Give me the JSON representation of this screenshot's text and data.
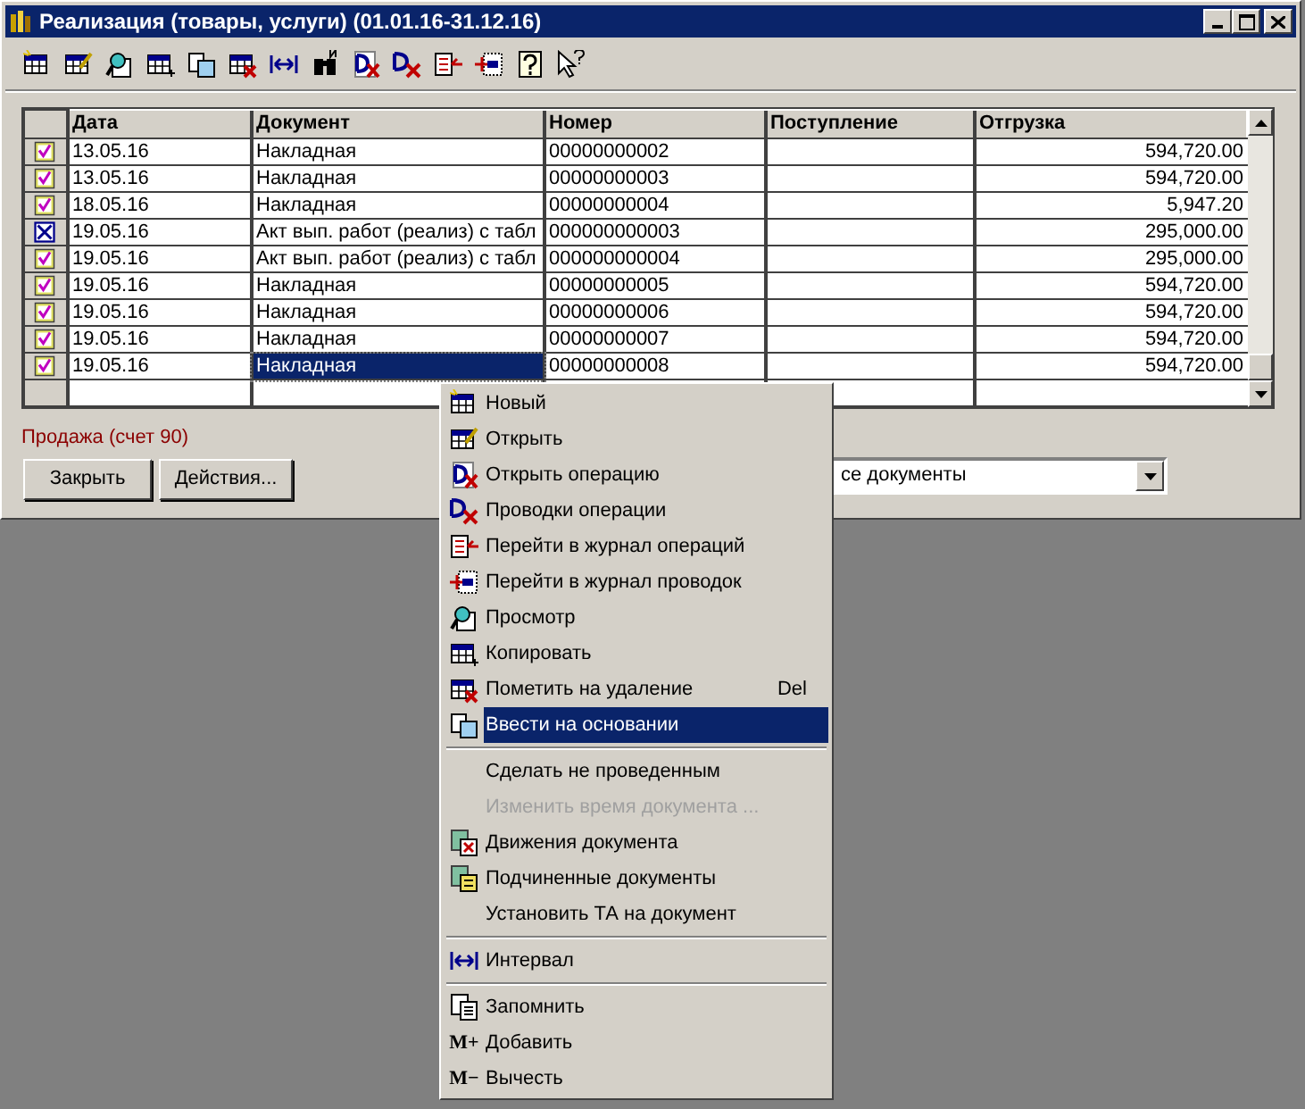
{
  "window": {
    "title": "Реализация (товары, услуги) (01.01.16-31.12.16)"
  },
  "table": {
    "columns": [
      "Дата",
      "Документ",
      "Номер",
      "Поступление",
      "Отгрузка"
    ],
    "rows": [
      {
        "deleted": false,
        "selected": false,
        "date": "13.05.16",
        "document": "Накладная",
        "number": "00000000002",
        "shipment": "594,720.00"
      },
      {
        "deleted": false,
        "selected": false,
        "date": "13.05.16",
        "document": "Накладная",
        "number": "00000000003",
        "shipment": "594,720.00"
      },
      {
        "deleted": false,
        "selected": false,
        "date": "18.05.16",
        "document": "Накладная",
        "number": "00000000004",
        "shipment": "5,947.20"
      },
      {
        "deleted": true,
        "selected": false,
        "date": "19.05.16",
        "document": "Акт вып. работ (реализ) с табл",
        "number": "000000000003",
        "shipment": "295,000.00"
      },
      {
        "deleted": false,
        "selected": false,
        "date": "19.05.16",
        "document": "Акт вып. работ (реализ) с табл",
        "number": "000000000004",
        "shipment": "295,000.00"
      },
      {
        "deleted": false,
        "selected": false,
        "date": "19.05.16",
        "document": "Накладная",
        "number": "00000000005",
        "shipment": "594,720.00"
      },
      {
        "deleted": false,
        "selected": false,
        "date": "19.05.16",
        "document": "Накладная",
        "number": "00000000006",
        "shipment": "594,720.00"
      },
      {
        "deleted": false,
        "selected": false,
        "date": "19.05.16",
        "document": "Накладная",
        "number": "00000000007",
        "shipment": "594,720.00"
      },
      {
        "deleted": false,
        "selected": true,
        "date": "19.05.16",
        "document": "Накладная",
        "number": "00000000008",
        "shipment": "594,720.00"
      }
    ]
  },
  "status_text": "Продажа (счет 90)",
  "buttons": [
    "Закрыть",
    "Действия..."
  ],
  "filter": {
    "value": "се документы"
  },
  "context_menu": {
    "items": [
      {
        "kind": "item",
        "label": "Новый",
        "selected": false,
        "disabled": false
      },
      {
        "kind": "item",
        "label": "Открыть",
        "selected": false,
        "disabled": false
      },
      {
        "kind": "item",
        "label": "Открыть операцию",
        "selected": false,
        "disabled": false
      },
      {
        "kind": "item",
        "label": "Проводки операции",
        "selected": false,
        "disabled": false
      },
      {
        "kind": "item",
        "label": "Перейти в журнал операций",
        "selected": false,
        "disabled": false
      },
      {
        "kind": "item",
        "label": "Перейти в журнал проводок",
        "selected": false,
        "disabled": false
      },
      {
        "kind": "item",
        "label": "Просмотр",
        "selected": false,
        "disabled": false
      },
      {
        "kind": "item",
        "label": "Копировать",
        "selected": false,
        "disabled": false
      },
      {
        "kind": "item",
        "label": "Пометить на удаление",
        "shortcut": "Del",
        "selected": false,
        "disabled": false
      },
      {
        "kind": "item",
        "label": "Ввести на основании",
        "selected": true,
        "disabled": false
      },
      {
        "kind": "separator"
      },
      {
        "kind": "item",
        "label": "Сделать  не проведенным",
        "selected": false,
        "disabled": false
      },
      {
        "kind": "item",
        "label": "Изменить время документа ...",
        "selected": false,
        "disabled": true
      },
      {
        "kind": "item",
        "label": "Движения документа",
        "selected": false,
        "disabled": false
      },
      {
        "kind": "item",
        "label": "Подчиненные документы",
        "selected": false,
        "disabled": false
      },
      {
        "kind": "item",
        "label": "Установить ТА на документ",
        "selected": false,
        "disabled": false
      },
      {
        "kind": "separator"
      },
      {
        "kind": "item",
        "label": "Интервал",
        "selected": false,
        "disabled": false
      },
      {
        "kind": "separator"
      },
      {
        "kind": "item",
        "label": "Запомнить",
        "selected": false,
        "disabled": false
      },
      {
        "kind": "item",
        "label": "Добавить",
        "glyph": "M+",
        "selected": false,
        "disabled": false
      },
      {
        "kind": "item",
        "label": "Вычесть",
        "glyph": "M−",
        "selected": false,
        "disabled": false
      }
    ]
  }
}
